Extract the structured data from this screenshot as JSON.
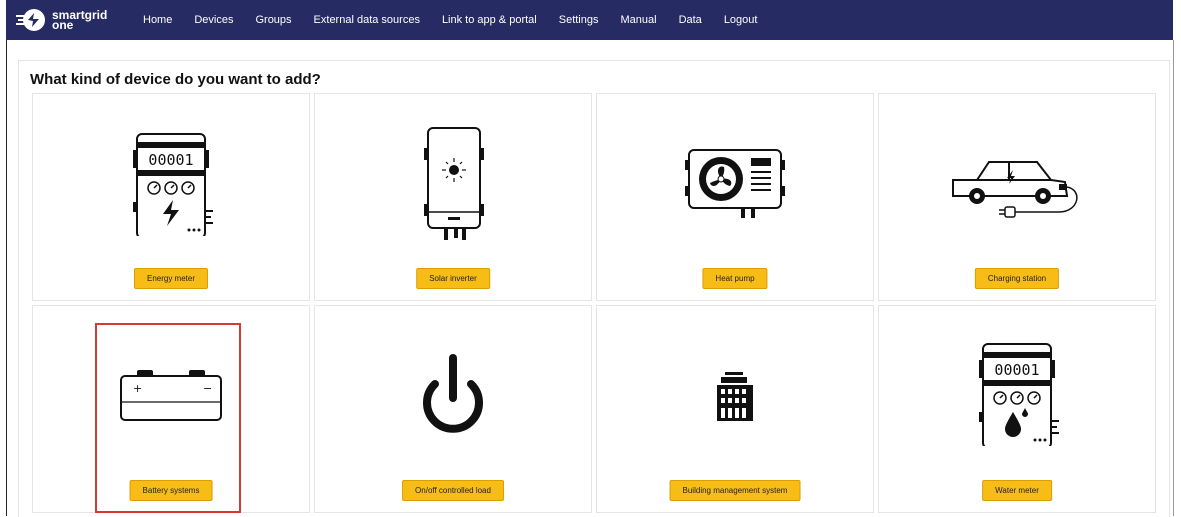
{
  "app": {
    "logo_line1": "smartgrid",
    "logo_line2": "one"
  },
  "nav": [
    "Home",
    "Devices",
    "Groups",
    "External data sources",
    "Link to app & portal",
    "Settings",
    "Manual",
    "Data",
    "Logout"
  ],
  "heading": "What kind of device do you want to add?",
  "devices": [
    {
      "label": "Energy meter",
      "icon": "energy-meter-icon",
      "counter": "00001"
    },
    {
      "label": "Solar inverter",
      "icon": "solar-inverter-icon"
    },
    {
      "label": "Heat pump",
      "icon": "heat-pump-icon"
    },
    {
      "label": "Charging station",
      "icon": "charging-station-icon"
    },
    {
      "label": "Battery systems",
      "icon": "battery-icon",
      "plus": "+",
      "minus": "−"
    },
    {
      "label": "On/off controlled load",
      "icon": "power-icon"
    },
    {
      "label": "Building management system",
      "icon": "building-icon"
    },
    {
      "label": "Water meter",
      "icon": "water-meter-icon",
      "counter": "00001"
    }
  ],
  "colors": {
    "navbar": "#272b63",
    "button": "#f7bd16",
    "highlight": "#d43a3a"
  }
}
